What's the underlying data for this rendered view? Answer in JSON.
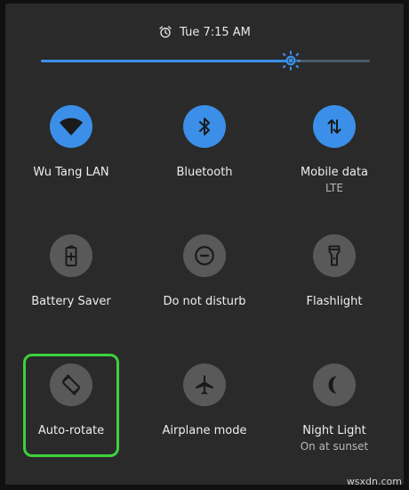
{
  "status": {
    "time": "Tue 7:15 AM",
    "alarm_icon": "alarm-clock-icon"
  },
  "brightness": {
    "level": 0.76
  },
  "tiles": [
    {
      "label": "Wu Tang LAN",
      "sub": "",
      "icon": "wifi-icon",
      "state": "on"
    },
    {
      "label": "Bluetooth",
      "sub": "",
      "icon": "bluetooth-icon",
      "state": "on"
    },
    {
      "label": "Mobile data",
      "sub": "LTE",
      "icon": "mobile-data-icon",
      "state": "on"
    },
    {
      "label": "Battery Saver",
      "sub": "",
      "icon": "battery-saver-icon",
      "state": "off"
    },
    {
      "label": "Do not disturb",
      "sub": "",
      "icon": "do-not-disturb-icon",
      "state": "off"
    },
    {
      "label": "Flashlight",
      "sub": "",
      "icon": "flashlight-icon",
      "state": "off"
    },
    {
      "label": "Auto-rotate",
      "sub": "",
      "icon": "auto-rotate-icon",
      "state": "off"
    },
    {
      "label": "Airplane mode",
      "sub": "",
      "icon": "airplane-icon",
      "state": "off"
    },
    {
      "label": "Night Light",
      "sub": "On at sunset",
      "icon": "night-light-icon",
      "state": "off"
    }
  ],
  "colors": {
    "accent": "#3b8fe8",
    "tile_off": "#595959",
    "panel_bg": "#2a2a2a",
    "highlight": "#3ed13e"
  },
  "watermark": "wsxdn.com"
}
